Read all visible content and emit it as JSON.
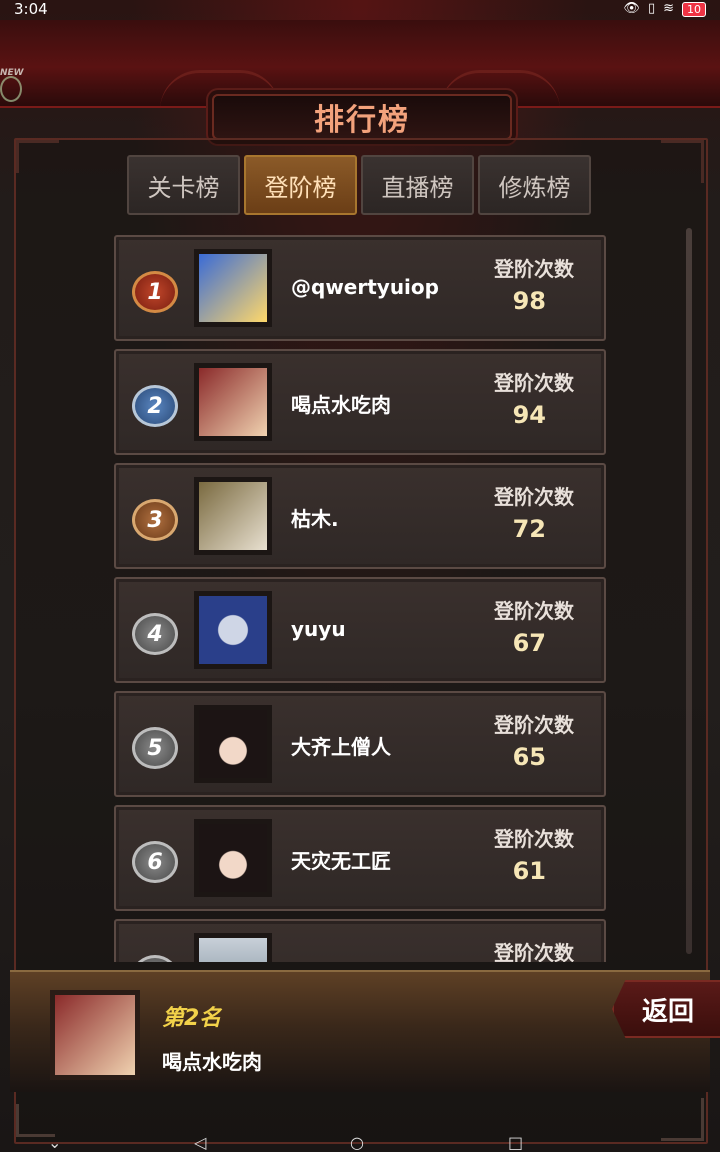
{
  "status_bar": {
    "time": "3:04",
    "battery": "10"
  },
  "title": "排行榜",
  "badge": "NEW",
  "tabs": [
    {
      "label": "关卡榜",
      "active": false
    },
    {
      "label": "登阶榜",
      "active": true
    },
    {
      "label": "直播榜",
      "active": false
    },
    {
      "label": "修炼榜",
      "active": false
    }
  ],
  "rows": [
    {
      "rank": "1",
      "name": "@qwertyuiop",
      "score_label": "登阶次数",
      "score": "98",
      "avatar_color": "#3a6bd6"
    },
    {
      "rank": "2",
      "name": "喝点水吃肉",
      "score_label": "登阶次数",
      "score": "94",
      "avatar_color": "#8a2a2a"
    },
    {
      "rank": "3",
      "name": "枯木.",
      "score_label": "登阶次数",
      "score": "72",
      "avatar_color": "#7a6a40"
    },
    {
      "rank": "4",
      "name": "yuyu",
      "score_label": "登阶次数",
      "score": "67",
      "avatar_color": "#2a3f8a"
    },
    {
      "rank": "5",
      "name": "大齐上僧人",
      "score_label": "登阶次数",
      "score": "65",
      "avatar_color": "#2a1c1c"
    },
    {
      "rank": "6",
      "name": "天灾无工匠",
      "score_label": "登阶次数",
      "score": "61",
      "avatar_color": "#2a1c1c"
    },
    {
      "rank": "",
      "name": "",
      "score_label": "登阶次数",
      "score": "",
      "avatar_color": "#9aa8b8"
    }
  ],
  "my_rank": {
    "rank_text": "第2名",
    "name": "喝点水吃肉"
  },
  "back_label": "返回"
}
